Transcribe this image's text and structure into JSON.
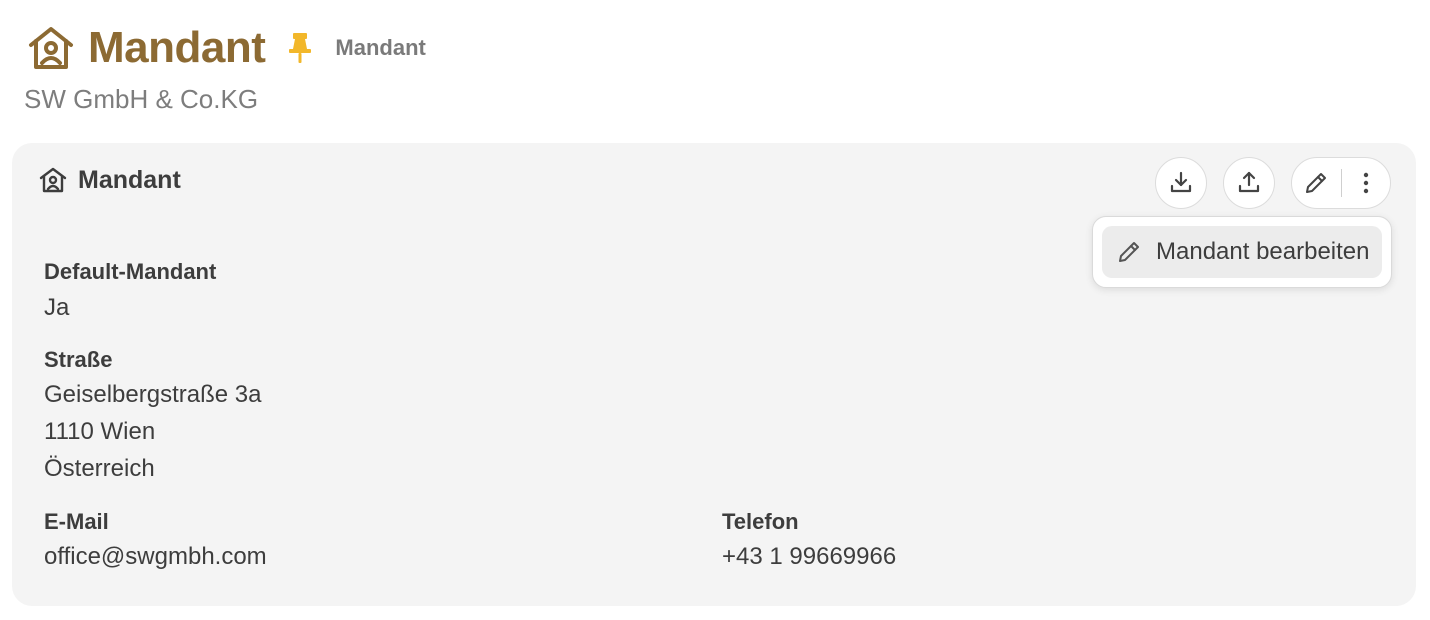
{
  "header": {
    "title": "Mandant",
    "breadcrumb": "Mandant",
    "subtitle": "SW GmbH & Co.KG"
  },
  "card": {
    "title": "Mandant",
    "actions": {
      "download": "download-icon",
      "upload": "upload-icon",
      "edit": "pencil-icon",
      "more": "more-vertical-icon"
    },
    "menu": {
      "items": [
        {
          "label": "Mandant bearbeiten",
          "icon": "pencil-icon"
        }
      ]
    },
    "fields": {
      "default_mandant": {
        "label": "Default-Mandant",
        "value": "Ja"
      },
      "strasse": {
        "label": "Straße",
        "lines": [
          "Geiselbergstraße 3a",
          "1110 Wien",
          "Österreich"
        ]
      },
      "email": {
        "label": "E-Mail",
        "value": "office@swgmbh.com"
      },
      "telefon": {
        "label": "Telefon",
        "value": "+43 1 99669966"
      }
    }
  },
  "colors": {
    "brand": "#8c6a33",
    "pin": "#f2b72a",
    "card_bg": "#f4f4f4"
  }
}
